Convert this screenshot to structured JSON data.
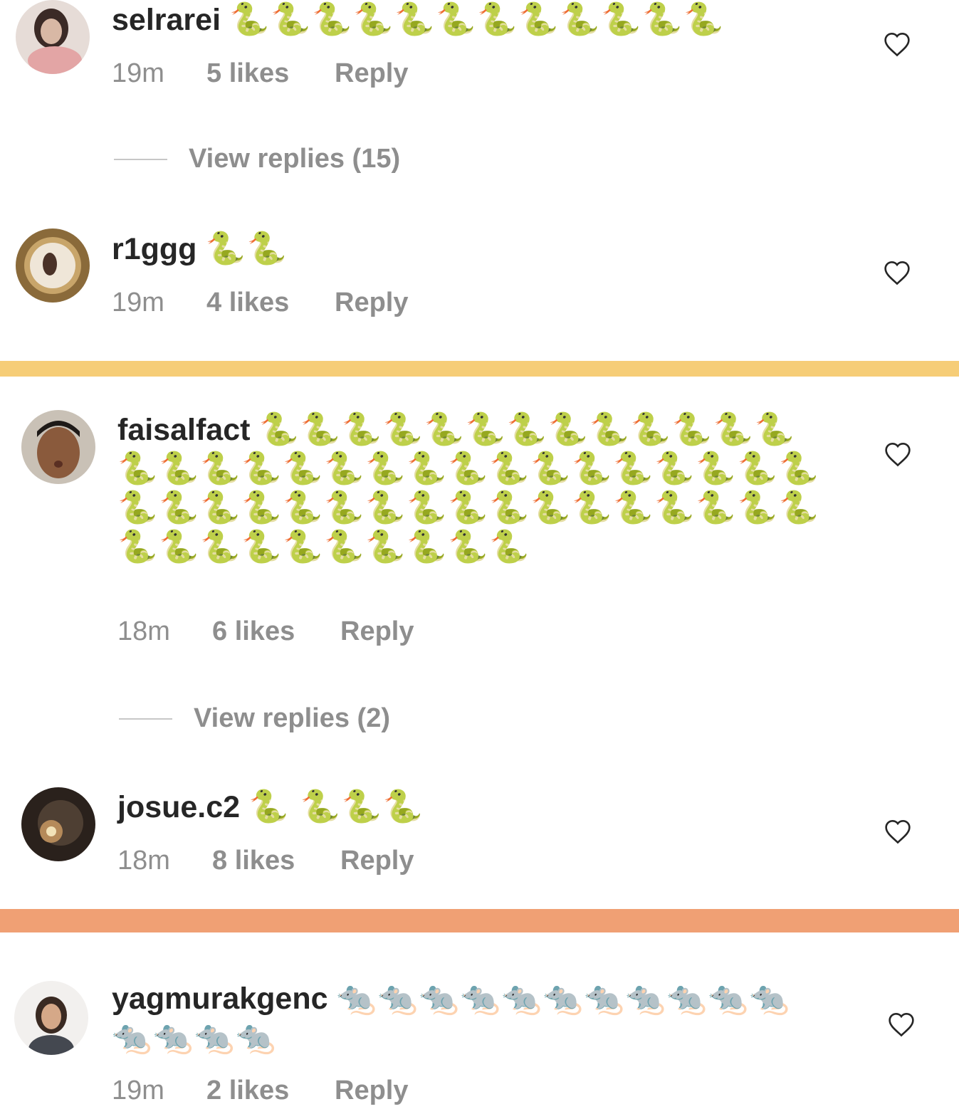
{
  "comments": [
    {
      "username": "selrarei",
      "text": "🐍🐍🐍🐍🐍🐍🐍🐍🐍🐍🐍🐍",
      "time": "19m",
      "likes": "5 likes",
      "reply": "Reply",
      "view_replies": "View replies (15)"
    },
    {
      "username": "r1ggg",
      "text": "🐍🐍",
      "time": "19m",
      "likes": "4 likes",
      "reply": "Reply"
    },
    {
      "username": "faisalfact",
      "text": "🐍🐍🐍🐍🐍🐍🐍🐍🐍🐍🐍🐍🐍🐍🐍🐍🐍🐍🐍🐍🐍🐍🐍🐍🐍🐍🐍🐍🐍🐍🐍🐍🐍🐍🐍🐍🐍🐍🐍🐍🐍🐍🐍🐍🐍🐍🐍🐍🐍🐍🐍🐍🐍🐍🐍🐍🐍",
      "time": "18m",
      "likes": "6 likes",
      "reply": "Reply",
      "view_replies": "View replies (2)"
    },
    {
      "username": "josue.c2",
      "text": "🐍 🐍🐍🐍",
      "time": "18m",
      "likes": "8 likes",
      "reply": "Reply"
    },
    {
      "username": "yagmurakgenc",
      "text": "🐀🐀🐀🐀🐀🐀🐀🐀🐀🐀🐀🐀🐀🐀🐀",
      "time": "19m",
      "likes": "2 likes",
      "reply": "Reply"
    }
  ],
  "colors": {
    "divider_yellow": "#f6cd77",
    "divider_orange": "#f0a074",
    "meta_gray": "#8e8e8e",
    "text_dark": "#262626"
  }
}
